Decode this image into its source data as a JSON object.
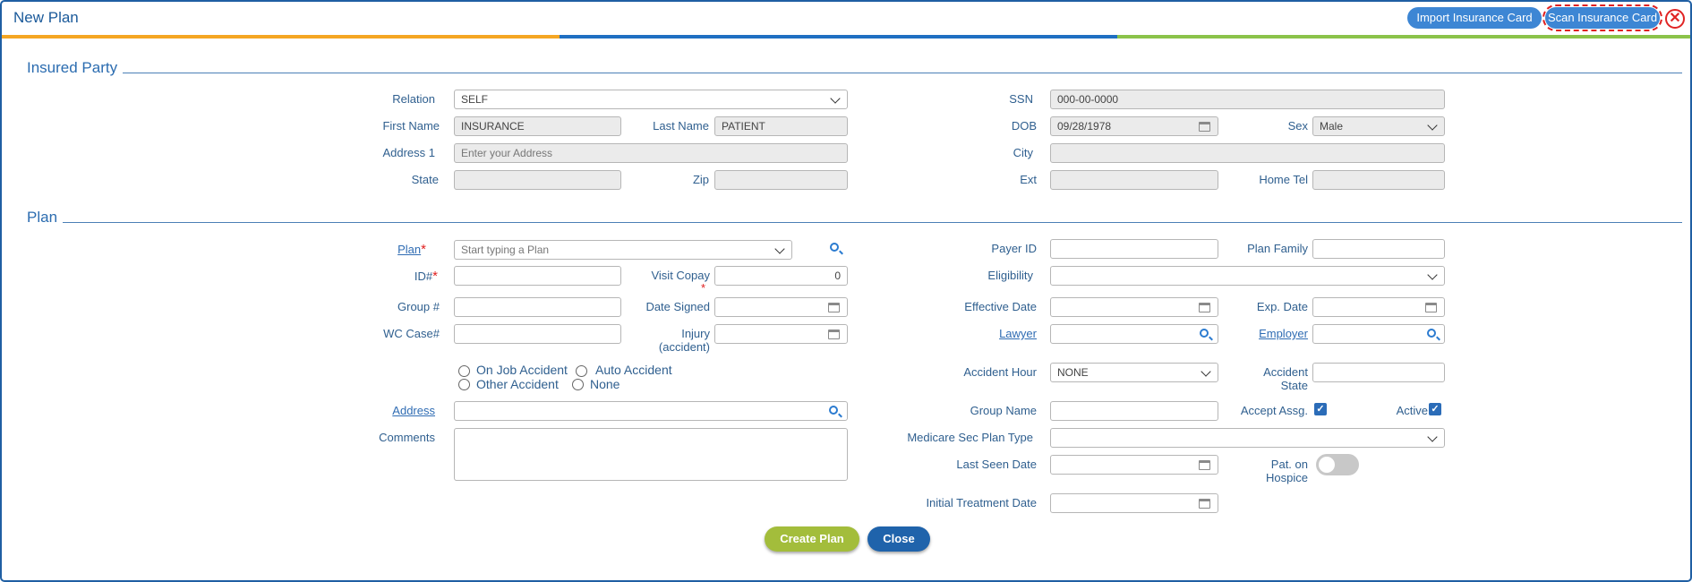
{
  "header": {
    "title": "New Plan",
    "import_label": "Import Insurance Card",
    "scan_label": "Scan Insurance Card",
    "close_glyph": "✕"
  },
  "colors": {
    "stripe_orange": "#f5a623",
    "stripe_blue": "#1f6fc2",
    "stripe_green": "#8bc34a",
    "create_green": "#a3bd3b",
    "close_blue": "#1f63ab"
  },
  "insured": {
    "section_title": "Insured Party",
    "relation_label": "Relation",
    "relation_value": "SELF",
    "first_name_label": "First Name",
    "first_name_value": "INSURANCE",
    "last_name_label": "Last Name",
    "last_name_value": "PATIENT",
    "address1_label": "Address 1",
    "address1_placeholder": "Enter your Address",
    "state_label": "State",
    "zip_label": "Zip",
    "ssn_label": "SSN",
    "ssn_value": "000-00-0000",
    "dob_label": "DOB",
    "dob_value": "09/28/1978",
    "sex_label": "Sex",
    "sex_value": "Male",
    "city_label": "City",
    "ext_label": "Ext",
    "home_tel_label": "Home Tel"
  },
  "plan": {
    "section_title": "Plan",
    "plan_label": "Plan",
    "plan_placeholder": "Start typing a Plan",
    "id_label": "ID#",
    "visit_copay_label": "Visit Copay",
    "visit_copay_value": "0",
    "group_label": "Group #",
    "date_signed_label": "Date Signed",
    "wc_case_label": "WC Case#",
    "injury_label_1": "Injury",
    "injury_label_2": "(accident)",
    "radios": {
      "on_job": "On Job Accident",
      "auto": "Auto Accident",
      "other": "Other Accident",
      "none": "None"
    },
    "address_label": "Address",
    "comments_label": "Comments",
    "payer_id_label": "Payer ID",
    "plan_family_label": "Plan Family",
    "eligibility_label": "Eligibility",
    "effective_date_label": "Effective Date",
    "exp_date_label": "Exp. Date",
    "lawyer_label": "Lawyer",
    "employer_label": "Employer",
    "accident_hour_label": "Accident Hour",
    "accident_hour_value": "NONE",
    "accident_state_label_1": "Accident",
    "accident_state_label_2": "State",
    "group_name_label": "Group Name",
    "accept_assg_label": "Accept Assg.",
    "accept_assg_checked": true,
    "active_label": "Active",
    "active_checked": true,
    "medicare_label": "Medicare Sec Plan Type",
    "last_seen_label": "Last Seen Date",
    "hospice_label_1": "Pat. on",
    "hospice_label_2": "Hospice",
    "hospice_on": false,
    "initial_treatment_label": "Initial Treatment Date"
  },
  "footer": {
    "create_label": "Create Plan",
    "close_label": "Close"
  }
}
